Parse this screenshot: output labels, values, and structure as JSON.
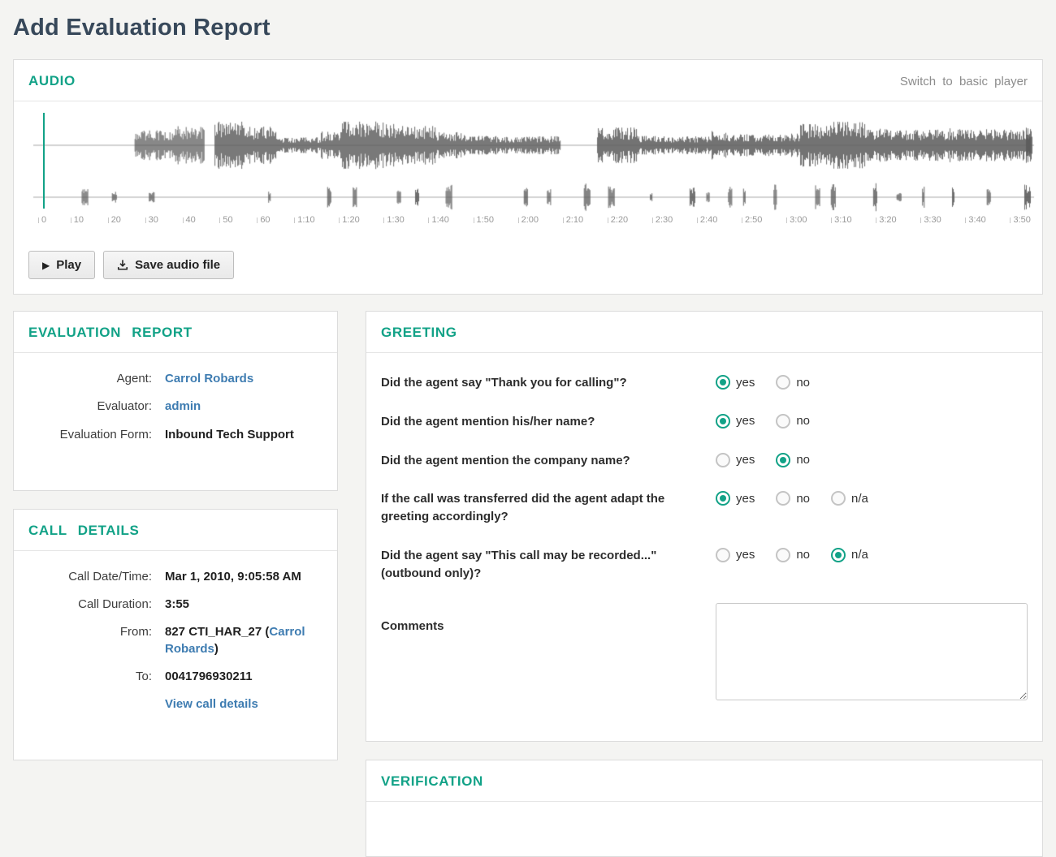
{
  "page": {
    "title": "Add Evaluation Report"
  },
  "audio": {
    "header": "AUDIO",
    "switch_link": "Switch to basic player",
    "play_icon": "▶",
    "play_label": "Play",
    "save_label": "Save audio file",
    "timeline": [
      "0",
      "10",
      "20",
      "30",
      "40",
      "50",
      "60",
      "1:10",
      "1:20",
      "1:30",
      "1:40",
      "1:50",
      "2:00",
      "2:10",
      "2:20",
      "2:30",
      "2:40",
      "2:50",
      "3:00",
      "3:10",
      "3:20",
      "3:30",
      "3:40",
      "3:50"
    ],
    "accent_color": "#12a287",
    "wave_color": "#5c5c5c"
  },
  "evaluation_report": {
    "header": "EVALUATION REPORT",
    "fields": [
      {
        "label": "Agent:",
        "value": "Carrol Robards",
        "style": "link"
      },
      {
        "label": "Evaluator:",
        "value": "admin",
        "style": "link"
      },
      {
        "label": "Evaluation Form:",
        "value": "Inbound Tech Support",
        "style": "text"
      }
    ]
  },
  "call_details": {
    "header": "CALL DETAILS",
    "fields": [
      {
        "label": "Call Date/Time:",
        "value": "Mar 1, 2010, 9:05:58 AM",
        "style": "text"
      },
      {
        "label": "Call Duration:",
        "value": "3:55",
        "style": "text"
      },
      {
        "label": "From:",
        "prefix": "827 CTI_HAR_27 (",
        "link": "Carrol Robards",
        "suffix": ")",
        "style": "composite"
      },
      {
        "label": "To:",
        "value": "0041796930211",
        "style": "text"
      }
    ],
    "view_link": "View call details"
  },
  "greeting": {
    "header": "GREETING",
    "questions": [
      {
        "text": "Did the agent say \"Thank you for calling\"?",
        "options": [
          "yes",
          "no"
        ],
        "selected": "yes"
      },
      {
        "text": "Did the agent mention his/her name?",
        "options": [
          "yes",
          "no"
        ],
        "selected": "yes"
      },
      {
        "text": "Did the agent mention the company name?",
        "options": [
          "yes",
          "no"
        ],
        "selected": "no"
      },
      {
        "text": "If the call was transferred did the agent adapt the greeting accordingly?",
        "options": [
          "yes",
          "no",
          "n/a"
        ],
        "selected": "yes"
      },
      {
        "text": "Did the agent say \"This call may be recorded...\" (outbound only)?",
        "options": [
          "yes",
          "no",
          "n/a"
        ],
        "selected": "n/a"
      }
    ],
    "comments_label": "Comments"
  },
  "verification": {
    "header": "VERIFICATION"
  }
}
